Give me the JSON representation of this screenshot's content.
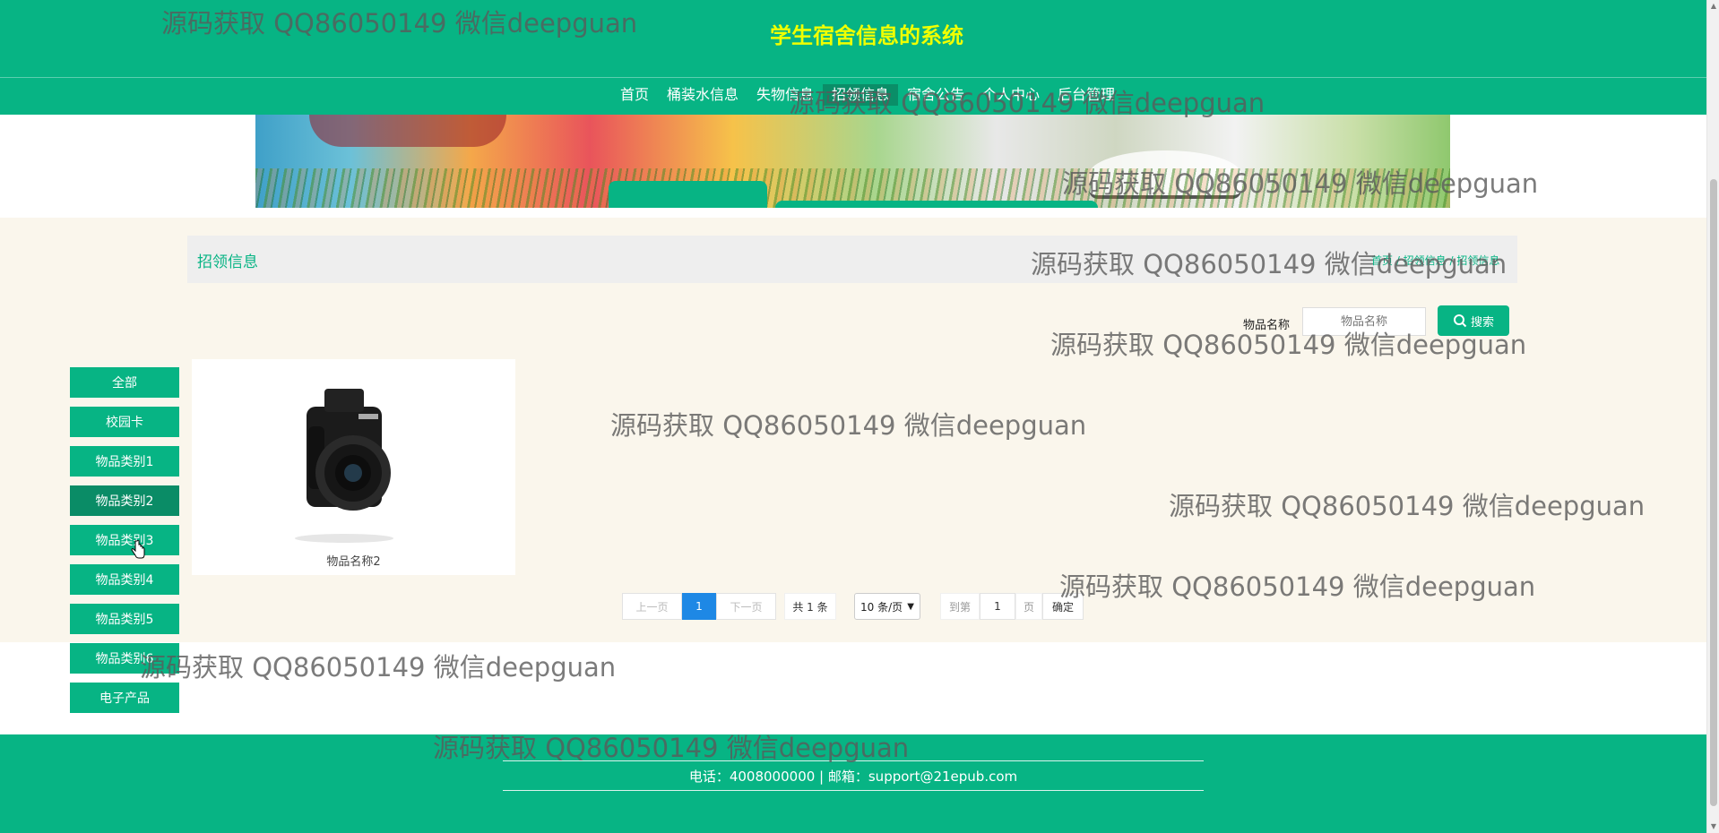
{
  "header": {
    "title": "学生宿舍信息的系统",
    "nav": [
      "首页",
      "桶装水信息",
      "失物信息",
      "招领信息",
      "宿舍公告",
      "个人中心",
      "后台管理"
    ],
    "active_nav_index": 3
  },
  "breadcrumb": {
    "title": "招领信息",
    "path": "首页 / 招领信息 / 招领信息"
  },
  "search": {
    "label": "物品名称",
    "placeholder": "物品名称",
    "button": "搜索",
    "icon": "search-icon"
  },
  "categories": [
    "全部",
    "校园卡",
    "物品类别1",
    "物品类别2",
    "物品类别3",
    "物品类别4",
    "物品类别5",
    "物品类别6",
    "电子产品"
  ],
  "active_category_index": 3,
  "products": [
    {
      "name": "物品名称2",
      "image": "camera"
    }
  ],
  "pagination": {
    "prev": "上一页",
    "current": "1",
    "next": "下一页",
    "total": "共 1 条",
    "page_size": "10 条/页",
    "goto_prefix": "到第",
    "goto_value": "1",
    "goto_suffix": "页",
    "confirm": "确定"
  },
  "footer": {
    "contact": "电话：4008000000 | 邮箱：support@21epub.com"
  },
  "watermark": "源码获取 QQ86050149 微信deepguan",
  "colors": {
    "primary": "#07b484",
    "title": "#f0ff00",
    "content_bg": "#faf6ec",
    "page_active": "#1e88e5"
  }
}
